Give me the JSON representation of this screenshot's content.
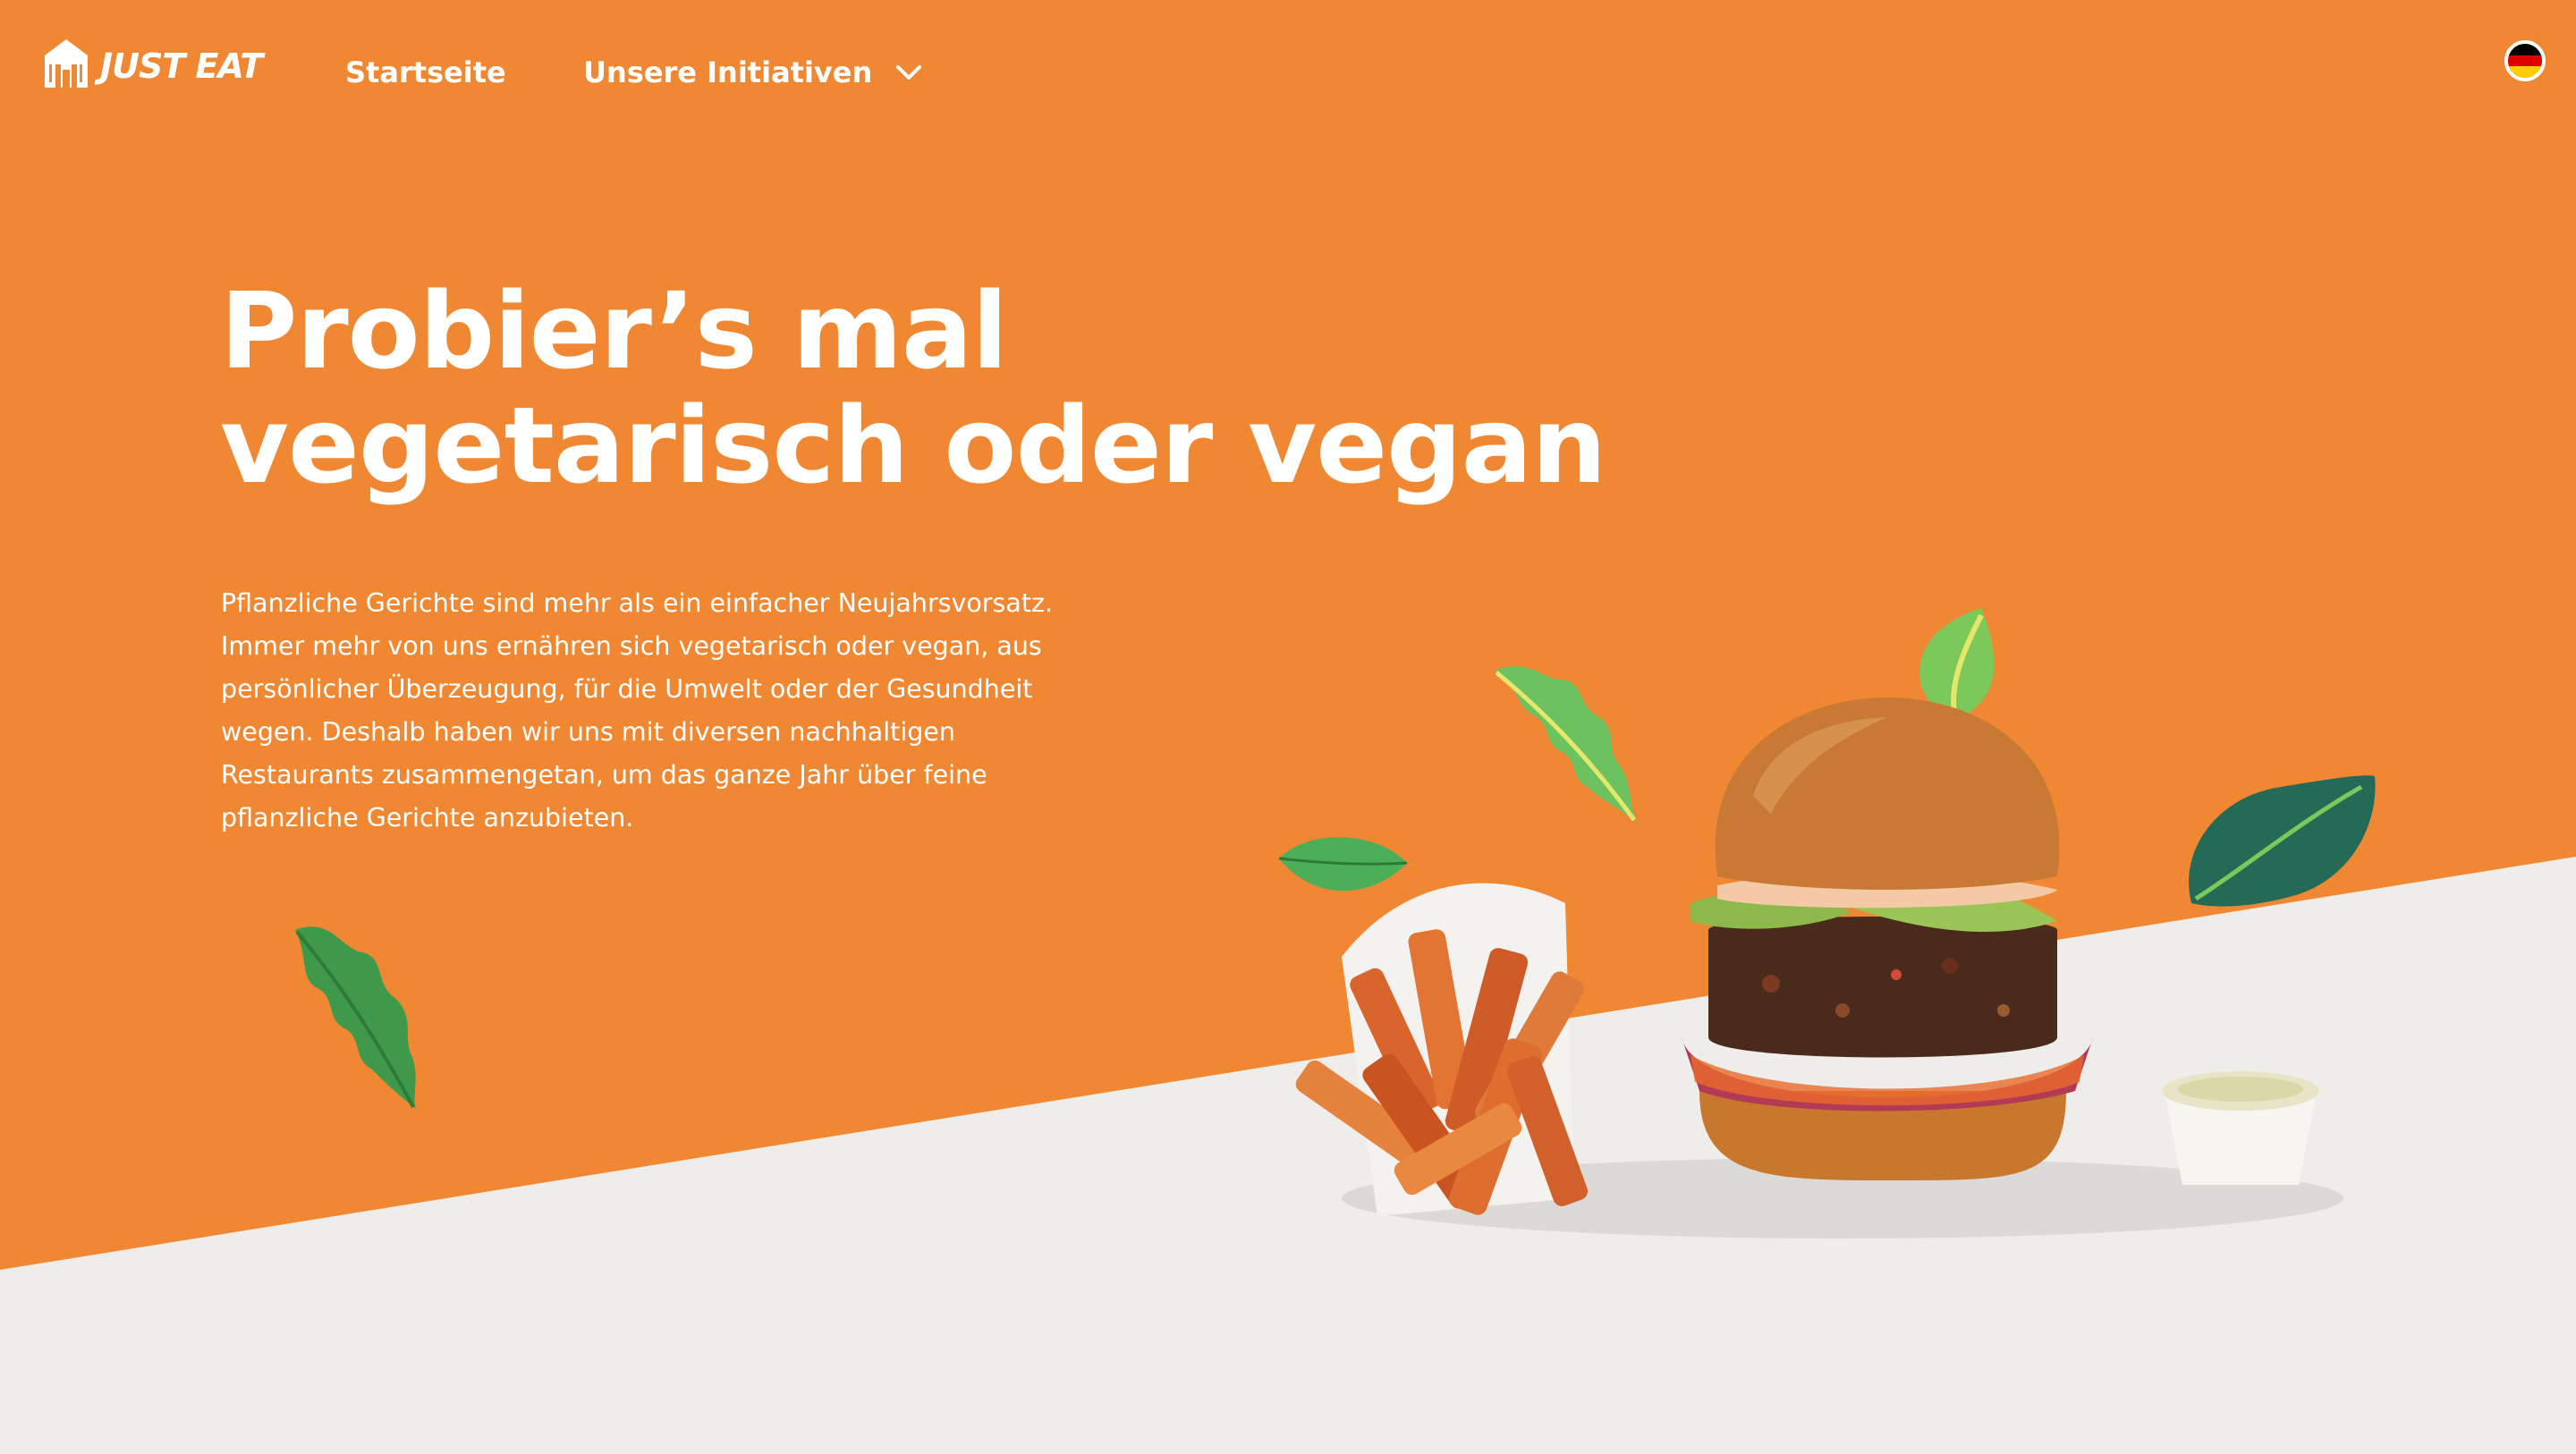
{
  "brand": {
    "name": "JUST EAT",
    "logo_icon": "house-cutlery-icon"
  },
  "nav": {
    "home_label": "Startseite",
    "initiatives_label": "Unsere Initiativen"
  },
  "language": {
    "flag": "germany-flag-icon"
  },
  "hero": {
    "title_line1": "Probier’s mal",
    "title_line2": "vegetarisch oder vegan",
    "text": "Pflanzliche Gerichte sind mehr als ein einfacher Neujahrsvorsatz. Immer mehr von uns ernähren sich vegetarisch oder vegan, aus persönlicher Überzeugung, für die Umwelt oder der Gesundheit wegen. Deshalb haben wir uns mit diversen nachhaltigen Restaurants zusammengetan, um das ganze Jahr über feine pflanzliche Gerichte anzubieten."
  },
  "colors": {
    "brand_orange": "#F08833",
    "background_grey": "#EFEDEA",
    "text_white": "#FFFFFF"
  }
}
